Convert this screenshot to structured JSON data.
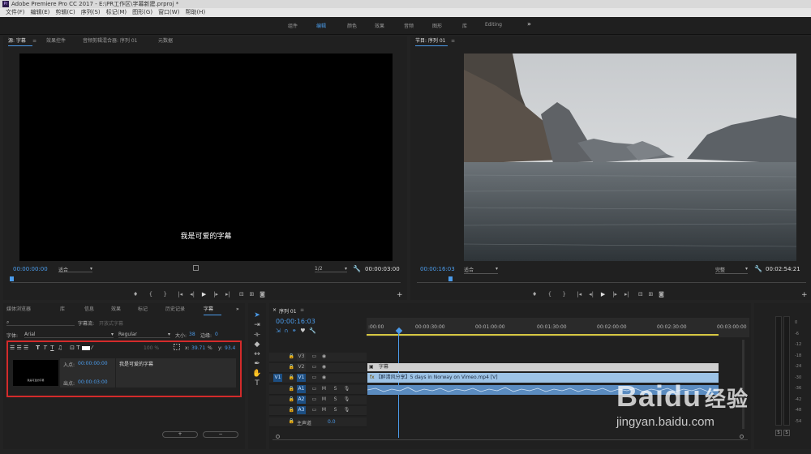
{
  "window": {
    "title": "Adobe Premiere Pro CC 2017 - E:\\PR工作区\\字幕新建.prproj *",
    "logo": "Pr"
  },
  "menu": [
    "文件(F)",
    "编辑(E)",
    "剪辑(C)",
    "序列(S)",
    "标记(M)",
    "图形(G)",
    "窗口(W)",
    "帮助(H)"
  ],
  "workspaces": {
    "items": [
      "组件",
      "编辑",
      "颜色",
      "效果",
      "音频",
      "图形",
      "库",
      "Editing"
    ],
    "active": "编辑",
    "more": "»"
  },
  "source": {
    "tabs": [
      "源: 字幕",
      "效果控件",
      "音频剪辑混合器: 序列 01",
      "元数据"
    ],
    "caption": "我是可爱的字幕",
    "timecode": "00:00:00:00",
    "fit": "适合",
    "resolution": "1/2",
    "duration": "00:00:03:00"
  },
  "program": {
    "tab": "节目: 序列 01",
    "timecode": "00:00:16:03",
    "fit": "适合",
    "quality": "完整",
    "duration": "00:02:54:21"
  },
  "bottom_tabs": [
    "媒体浏览器",
    "库",
    "信息",
    "效果",
    "标记",
    "历史记录",
    "字幕"
  ],
  "captions": {
    "stream_label": "字幕流:",
    "stream_value": "开放式字幕",
    "font_label": "字体:",
    "font": "Arial",
    "style": "Regular",
    "size_label": "大小:",
    "size": "38",
    "edge_label": "边缘:",
    "edge": "0",
    "opacity": "100 %",
    "x_label": "x:",
    "x": "39.71",
    "y_label": "y:",
    "y": "93.4",
    "pct": "%",
    "in_label": "入点:",
    "in": "00:00:00:00",
    "out_label": "出点:",
    "out": "00:00:03:00",
    "text": "我是可爱的字幕",
    "thumb_text": "我是可爱的字幕"
  },
  "timeline": {
    "tab": "序列 01",
    "timecode": "00:00:16:03",
    "ruler": [
      ":00:00",
      "00:00:30:00",
      "00:01:00:00",
      "00:01:30:00",
      "00:02:00:00",
      "00:02:30:00",
      "00:03:00:00"
    ],
    "tracks": [
      {
        "name": "V3"
      },
      {
        "name": "V2"
      },
      {
        "name": "V1",
        "source": "V1"
      },
      {
        "name": "A1",
        "source": ""
      },
      {
        "name": "A2"
      },
      {
        "name": "A3"
      }
    ],
    "master": "主声道",
    "master_value": "0.0",
    "clips": {
      "caption": "字幕",
      "video": "【醉清风分享】5 days in Norway on Vimeo.mp4 [V]"
    }
  },
  "meters": {
    "labels": [
      "0",
      "-6",
      "-12",
      "-18",
      "-24",
      "-30",
      "-36",
      "-42",
      "-48",
      "-54"
    ],
    "solo": [
      "S",
      "S"
    ]
  },
  "watermark": {
    "brand": "Baidu",
    "brand_cn": "经验",
    "url": "jingyan.baidu.com"
  }
}
